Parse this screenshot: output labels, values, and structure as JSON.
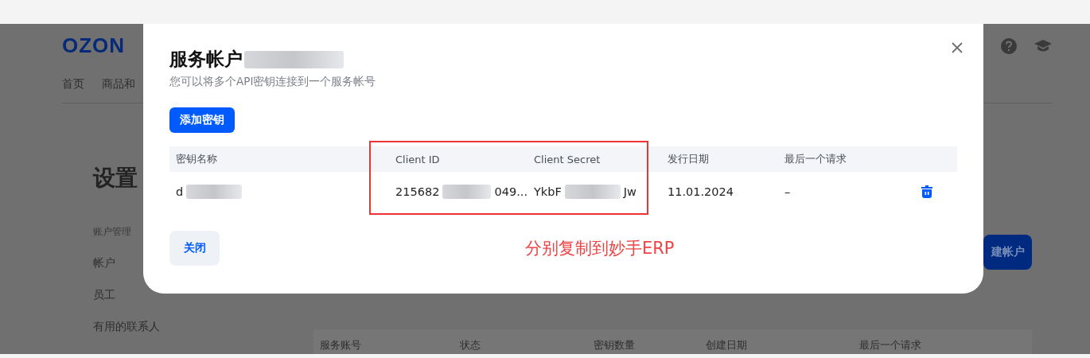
{
  "page": {
    "logo": "OZON",
    "nav": [
      "首页",
      "商品和"
    ],
    "heading": "设置",
    "sidebar": {
      "section": "账户管理",
      "items": [
        "帐户",
        "员工",
        "有用的联系人"
      ]
    },
    "create_button": "建帐户",
    "table": {
      "columns": [
        "服务账号",
        "状态",
        "密钥数量",
        "创建日期",
        "最后一个请求"
      ]
    }
  },
  "modal": {
    "title": "服务帐户",
    "subtitle": "您可以将多个API密钥连接到一个服务帐号",
    "add_button": "添加密钥",
    "table": {
      "columns": [
        "密钥名称",
        "Client ID",
        "Client Secret",
        "发行日期",
        "最后一个请求"
      ],
      "rows": [
        {
          "name": [
            "d"
          ],
          "client_id": [
            "215682",
            "049..."
          ],
          "client_secret": [
            "YkbF",
            "Jw"
          ],
          "issue_date": "11.01.2024",
          "last_request": "–"
        }
      ]
    },
    "close_button": "关闭"
  },
  "annotation": {
    "text": "分别复制到妙手ERP"
  }
}
